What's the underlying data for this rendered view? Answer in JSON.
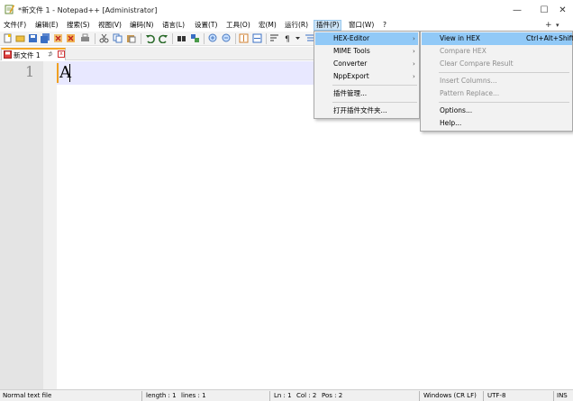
{
  "window": {
    "title": "*新文件 1 - Notepad++ [Administrator]",
    "minimize_glyph": "—",
    "maximize_glyph": "☐",
    "close_glyph": "✕"
  },
  "menubar": {
    "items": [
      {
        "label": "文件(F)"
      },
      {
        "label": "编辑(E)"
      },
      {
        "label": "搜索(S)"
      },
      {
        "label": "视图(V)"
      },
      {
        "label": "编码(N)"
      },
      {
        "label": "语言(L)"
      },
      {
        "label": "设置(T)"
      },
      {
        "label": "工具(O)"
      },
      {
        "label": "宏(M)"
      },
      {
        "label": "运行(R)"
      },
      {
        "label": "插件(P)"
      },
      {
        "label": "窗口(W)"
      },
      {
        "label": "?"
      }
    ],
    "right_plus": "+",
    "right_arrow": "▾",
    "right_close": "✕"
  },
  "toolbar": {
    "icons": [
      "new-icon",
      "open-icon",
      "save-icon",
      "save-all-icon",
      "close-icon",
      "close-all-icon",
      "print-icon",
      "cut-icon",
      "copy-icon",
      "paste-icon",
      "undo-icon",
      "redo-icon",
      "find-icon",
      "replace-icon",
      "zoom-in-icon",
      "zoom-out-icon",
      "sync-v-icon",
      "sync-h-icon",
      "wrap-icon",
      "show-all-icon",
      "indent-guide-icon"
    ]
  },
  "tab": {
    "label": "新文件 1",
    "pin_glyph": "⊅",
    "close_glyph": "x"
  },
  "editor": {
    "line_number": "1",
    "content": "A"
  },
  "statusbar": {
    "file_type": "Normal text file",
    "length": "length : 1",
    "lines": "lines : 1",
    "ln": "Ln : 1",
    "col": "Col : 2",
    "pos": "Pos : 2",
    "eol": "Windows (CR LF)",
    "encoding": "UTF-8",
    "mode": "INS"
  },
  "plugins_menu": {
    "items": [
      {
        "label": "HEX-Editor",
        "submenu": true,
        "highlight": true
      },
      {
        "label": "MIME Tools",
        "submenu": true
      },
      {
        "label": "Converter",
        "submenu": true
      },
      {
        "label": "NppExport",
        "submenu": true
      },
      {
        "label": "插件管理..."
      },
      {
        "label": "打开插件文件夹..."
      }
    ],
    "arrow_glyph": "›"
  },
  "hex_submenu": {
    "items": [
      {
        "label": "View in HEX",
        "shortcut": "Ctrl+Alt+Shift+H",
        "highlight": true
      },
      {
        "label": "Compare HEX",
        "disabled": true
      },
      {
        "label": "Clear Compare Result",
        "disabled": true
      },
      {
        "label": "Insert Columns...",
        "disabled": true
      },
      {
        "label": "Pattern Replace...",
        "disabled": true
      },
      {
        "label": "Options..."
      },
      {
        "label": "Help..."
      }
    ]
  },
  "colors": {
    "menu_highlight": "#91c9f7",
    "active_menu": "#cce4f7",
    "tab_accent": "#f5a623",
    "current_line": "#e8e8ff",
    "close_red": "#d03030"
  }
}
